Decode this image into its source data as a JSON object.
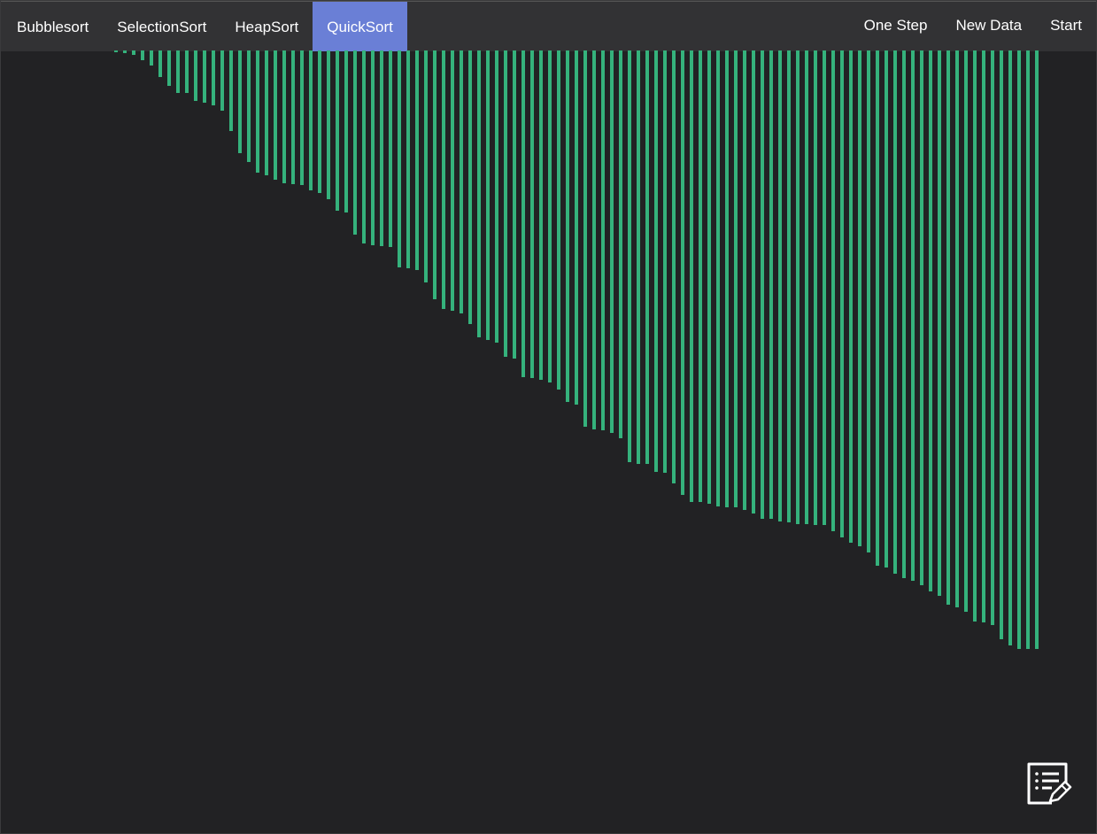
{
  "nav": {
    "algorithms": [
      {
        "label": "Bubblesort",
        "active": false
      },
      {
        "label": "SelectionSort",
        "active": false
      },
      {
        "label": "HeapSort",
        "active": false
      },
      {
        "label": "QuickSort",
        "active": true
      }
    ],
    "actions": [
      {
        "label": "One Step"
      },
      {
        "label": "New Data"
      },
      {
        "label": "Start"
      }
    ]
  },
  "colors": {
    "background": "#222224",
    "navbar": "#323234",
    "active_tab": "#6a7fd6",
    "bar": "#35b27c"
  },
  "icons": {
    "notes": "notes-edit-icon"
  },
  "chart_data": {
    "type": "bar",
    "description_orientation": "bars hang from top",
    "values": [
      2,
      3,
      5,
      11,
      17,
      30,
      40,
      48,
      48,
      57,
      59,
      62,
      68,
      91,
      116,
      126,
      138,
      141,
      146,
      150,
      151,
      152,
      158,
      161,
      168,
      181,
      183,
      208,
      218,
      220,
      221,
      222,
      245,
      246,
      248,
      262,
      281,
      292,
      294,
      297,
      309,
      324,
      327,
      330,
      346,
      348,
      369,
      370,
      372,
      375,
      383,
      397,
      400,
      425,
      428,
      429,
      432,
      438,
      465,
      467,
      467,
      476,
      477,
      489,
      502,
      510,
      510,
      512,
      515,
      516,
      516,
      519,
      523,
      529,
      529,
      532,
      533,
      535,
      535,
      536,
      536,
      543,
      550,
      556,
      560,
      567,
      582,
      584,
      591,
      596,
      599,
      604,
      611,
      616,
      626,
      629,
      634,
      645,
      646,
      649,
      665,
      672,
      676,
      676,
      676
    ]
  }
}
